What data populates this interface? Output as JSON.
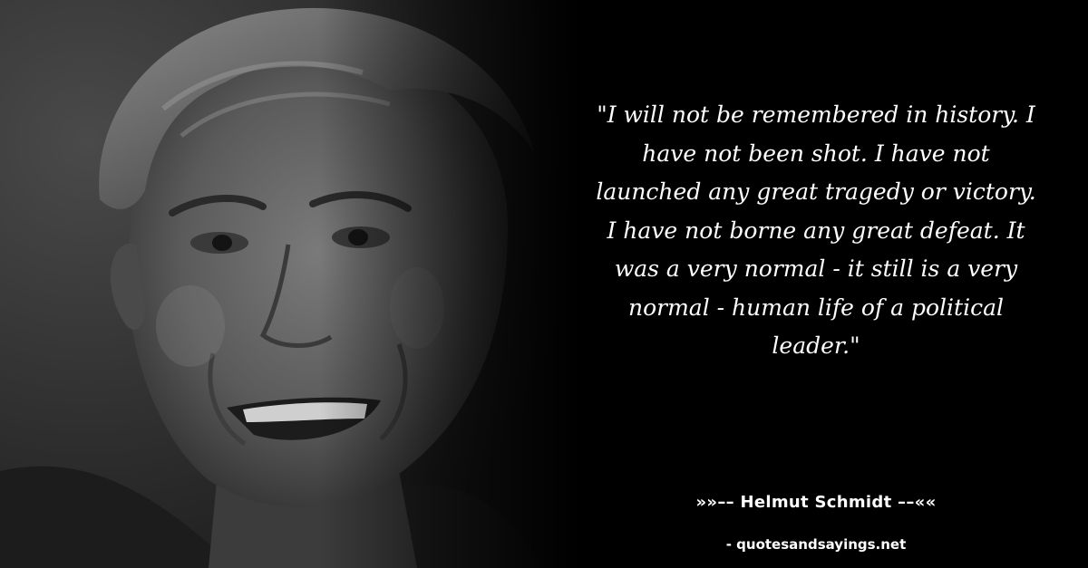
{
  "quote": {
    "text": "\"I will not be remembered in history. I have not been shot. I have not launched any great tragedy or victory. I have not borne any great defeat. It was a very normal - it still is a very normal - human life of a political leader.\""
  },
  "author": {
    "line": "»»–– Helmut Schmidt ––««"
  },
  "footer": {
    "site": "- quotesandsayings.net"
  },
  "colors": {
    "background": "#000000",
    "text": "#ffffff"
  }
}
